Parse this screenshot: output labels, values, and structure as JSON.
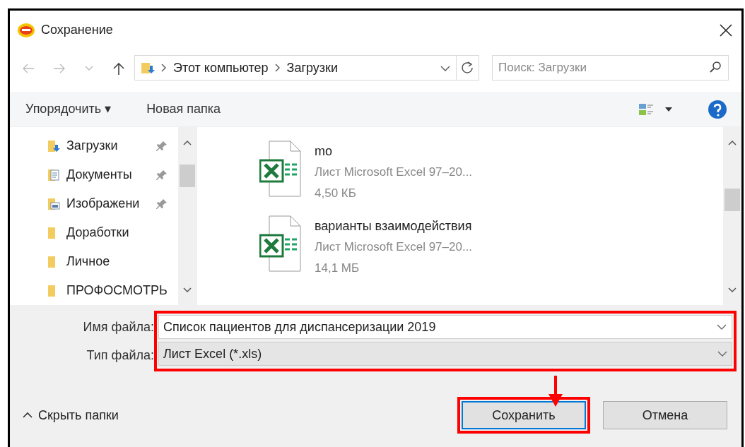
{
  "window": {
    "title": "Сохранение"
  },
  "address": {
    "path": [
      "Этот компьютер",
      "Загрузки"
    ],
    "search_placeholder": "Поиск: Загрузки"
  },
  "toolbar": {
    "organize": "Упорядочить ▾",
    "new_folder": "Новая папка"
  },
  "nav_items": [
    {
      "label": "Загрузки",
      "kind": "downloads",
      "pinned": true
    },
    {
      "label": "Документы",
      "kind": "documents",
      "pinned": true
    },
    {
      "label": "Изображени",
      "kind": "pictures",
      "pinned": true
    },
    {
      "label": "Доработки",
      "kind": "folder",
      "pinned": false
    },
    {
      "label": "Личное",
      "kind": "folder",
      "pinned": false
    },
    {
      "label": "ПРОФОСМОТРЬ",
      "kind": "folder",
      "pinned": false
    }
  ],
  "files": [
    {
      "name": "mo",
      "type": "Лист Microsoft Excel 97–20...",
      "size": "4,50 КБ"
    },
    {
      "name": "варианты взаимодействия",
      "type": "Лист Microsoft Excel 97–20...",
      "size": "14,1 МБ"
    }
  ],
  "form": {
    "highlighted": true,
    "filename_label": "Имя файла:",
    "filename": "Список пациентов для диспансеризации 2019",
    "filetype_label": "Тип файла:",
    "filetype": "Лист Excel (*.xls)"
  },
  "hide_folders": "Скрыть папки",
  "buttons": [
    {
      "label": "Сохранить",
      "kind": "primary",
      "highlighted": true
    },
    {
      "label": "Отмена",
      "kind": "secondary"
    }
  ]
}
